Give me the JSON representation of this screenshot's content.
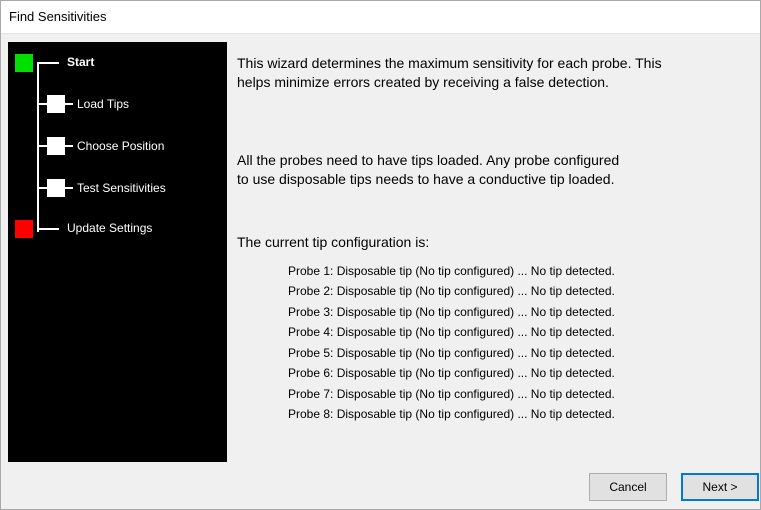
{
  "window": {
    "title": "Find Sensitivities"
  },
  "steps": [
    {
      "label": "Start",
      "status": "complete",
      "color": "#00e000"
    },
    {
      "label": "Load Tips",
      "status": "pending",
      "color": "#ffffff"
    },
    {
      "label": "Choose Position",
      "status": "pending",
      "color": "#ffffff"
    },
    {
      "label": "Test Sensitivities",
      "status": "pending",
      "color": "#ffffff"
    },
    {
      "label": "Update Settings",
      "status": "error",
      "color": "#ff0000"
    }
  ],
  "intro": {
    "line1": "This wizard determines the maximum sensitivity for each probe.  This",
    "line2": "helps minimize errors created by receiving a false detection."
  },
  "tips_note": {
    "line1": "All the probes need to have tips loaded.  Any probe configured",
    "line2": "to use disposable tips needs to have a conductive tip loaded."
  },
  "config_heading": "The current tip configuration is:",
  "probes": [
    "Probe 1:  Disposable tip (No tip configured) ... No tip detected.",
    "Probe 2:  Disposable tip (No tip configured) ... No tip detected.",
    "Probe 3:  Disposable tip (No tip configured) ... No tip detected.",
    "Probe 4:  Disposable tip (No tip configured) ... No tip detected.",
    "Probe 5:  Disposable tip (No tip configured) ... No tip detected.",
    "Probe 6:  Disposable tip (No tip configured) ... No tip detected.",
    "Probe 7:  Disposable tip (No tip configured) ... No tip detected.",
    "Probe 8:  Disposable tip (No tip configured) ... No tip detected."
  ],
  "buttons": {
    "cancel": "Cancel",
    "next": "Next >"
  },
  "colors": {
    "sidebar": "#000000",
    "done": "#00e000",
    "error": "#ff0000",
    "focus": "#0078d7"
  }
}
